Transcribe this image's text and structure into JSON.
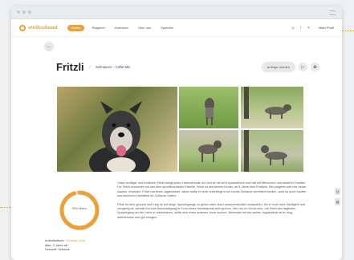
{
  "nav": {
    "logo_text": "stellenhund",
    "items": [
      {
        "label": "Hunde",
        "active": true
      },
      {
        "label": "Ratgeber",
        "active": false
      },
      {
        "label": "Adressen",
        "active": false
      },
      {
        "label": "Über uns",
        "active": false
      },
      {
        "label": "Spenden",
        "active": false
      }
    ],
    "icons": [
      "instagram-icon",
      "facebook-icon",
      "twitter-icon"
    ],
    "profile_label": "Mein Profil"
  },
  "dog": {
    "name": "Fritzli",
    "gender_symbol": "♂",
    "breed": "Schnauzer – Collie Mix",
    "action_label": "Anfrage senden",
    "progress_label": "95% Match",
    "progress_value": 0.95,
    "facts": {
      "shelter_label": "Aufenthaltsort:",
      "shelter_value": "Tierheim Lindli",
      "age": "Alter: 2 Jahre alt",
      "origin": "Herkunft: Schweiz"
    },
    "description": [
      "Unser drolliger und frohlicher Fritzli bringt jeden Lebensfreude ein und ist mit sehr sympathisch und hat mit Menschen und anderen Hunden. Fur Fritzli wunschen wir uns eine sportliche/aktive Familie. Fritzli ist mit kleinen Kinder, ab 8 Jahre kein Problem. Bei jungeren wei tele heute nassen, erwarten. Fritzli hat einen Jagdinstinkt, daher sollte er nicht unbedingt in ein neues Zuhause vermittelt werden, wohl ist auch Katzen und kleineren Haustiere fur Zuhause haben.",
      "Fritzli ist sehr gesund und mag es auf lange Spaziergange zu gehen aber auch ausserordentlich ausspielen. Da er noch sehr intelligent und neugierig ist, schatzt ihn eine Beschaftigung in Form eines Hundesports sehr gut tun. Wer nur im Dreck sein, mit Fritzli den taglichen Spaziergang an der Leine zu absolvieren, sollte sich einen anderen Hund suchen. Nebenbei ein bei seinen Jagdinstinkt ist er klug, aufmerksam und gut erzogen."
    ]
  }
}
